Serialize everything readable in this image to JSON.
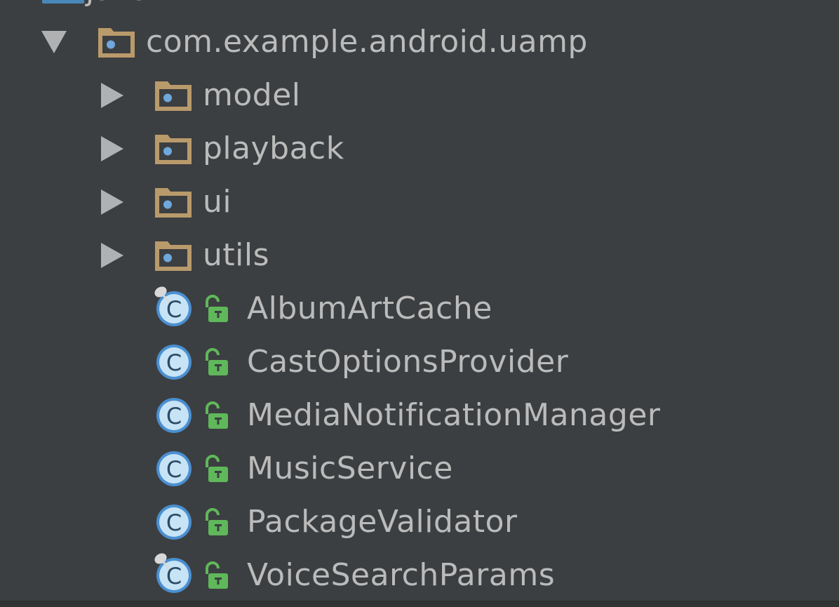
{
  "tree": {
    "parent_fragment": "java",
    "root": {
      "label": "com.example.android.uamp",
      "icon": "package-folder-icon",
      "expanded": true
    },
    "packages": [
      {
        "label": "model",
        "icon": "package-folder-icon",
        "expanded": false
      },
      {
        "label": "playback",
        "icon": "package-folder-icon",
        "expanded": false
      },
      {
        "label": "ui",
        "icon": "package-folder-icon",
        "expanded": false
      },
      {
        "label": "utils",
        "icon": "package-folder-icon",
        "expanded": false
      }
    ],
    "classes": [
      {
        "label": "AlbumArtCache",
        "icon": "class-icon",
        "pinned": true,
        "visibility": "public"
      },
      {
        "label": "CastOptionsProvider",
        "icon": "class-icon",
        "pinned": false,
        "visibility": "public"
      },
      {
        "label": "MediaNotificationManager",
        "icon": "class-icon",
        "pinned": false,
        "visibility": "public"
      },
      {
        "label": "MusicService",
        "icon": "class-icon",
        "pinned": false,
        "visibility": "public"
      },
      {
        "label": "PackageValidator",
        "icon": "class-icon",
        "pinned": false,
        "visibility": "public"
      },
      {
        "label": "VoiceSearchParams",
        "icon": "class-icon",
        "pinned": true,
        "visibility": "public"
      }
    ]
  },
  "colors": {
    "background": "#3c3f41",
    "text": "#bbbbbb",
    "arrow": "#afb1b3",
    "folder": "#b99a6b",
    "folder_dot": "#6fa8dc",
    "class_circle": "#c7e3f6",
    "class_ring": "#4a8fd1",
    "lock": "#5fb85a"
  }
}
